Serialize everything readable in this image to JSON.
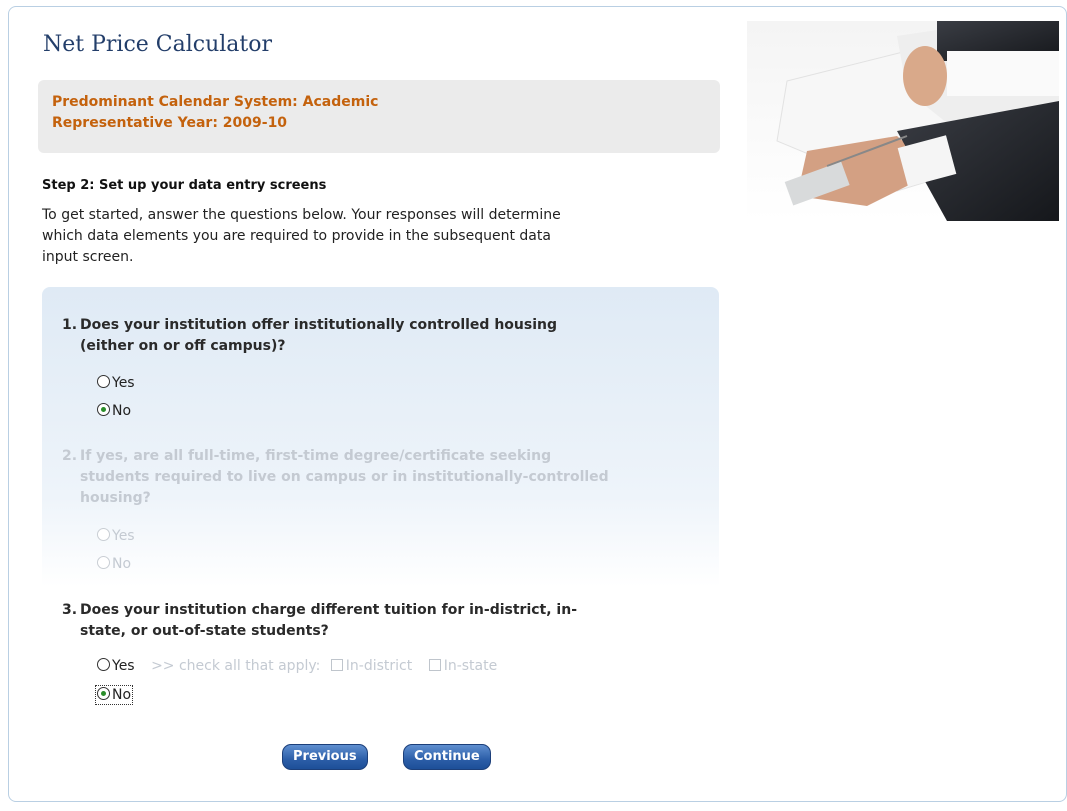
{
  "page": {
    "title": "Net Price Calculator",
    "calendar_line": "Predominant Calendar System: Academic",
    "year_line": "Representative Year: 2009-10",
    "step_heading": "Step 2: Set up your data entry screens",
    "intro_line1": "To get started, answer the questions below. Your responses will determine",
    "intro_line2": "which data elements you are required to provide in the subsequent data",
    "intro_line3": "input screen."
  },
  "questions": [
    {
      "number": "1.",
      "line1": "Does your institution offer institutionally controlled housing",
      "line2": "(either on or off campus)?",
      "options": [
        "Yes",
        "No"
      ],
      "selected": "No",
      "enabled": true
    },
    {
      "number": "2.",
      "line1": "If yes, are all full-time, first-time degree/certificate seeking",
      "line2": "students required to live on campus or in institutionally-controlled",
      "line3": "housing?",
      "options": [
        "Yes",
        "No"
      ],
      "selected": null,
      "enabled": false
    },
    {
      "number": "3.",
      "line1": "Does your institution charge different tuition for in-district, in-",
      "line2": "state, or out-of-state students?",
      "options": [
        "Yes",
        "No"
      ],
      "selected": "No",
      "enabled": true,
      "check_prompt": ">> check all that apply:",
      "checkboxes": [
        "In-district",
        "In-state"
      ]
    }
  ],
  "buttons": {
    "previous": "Previous",
    "continue": "Continue"
  },
  "colors": {
    "title": "#233e6a",
    "calendar_text": "#c4620d",
    "button": "#2c5ea8",
    "disabled_text": "#c4cad2"
  }
}
